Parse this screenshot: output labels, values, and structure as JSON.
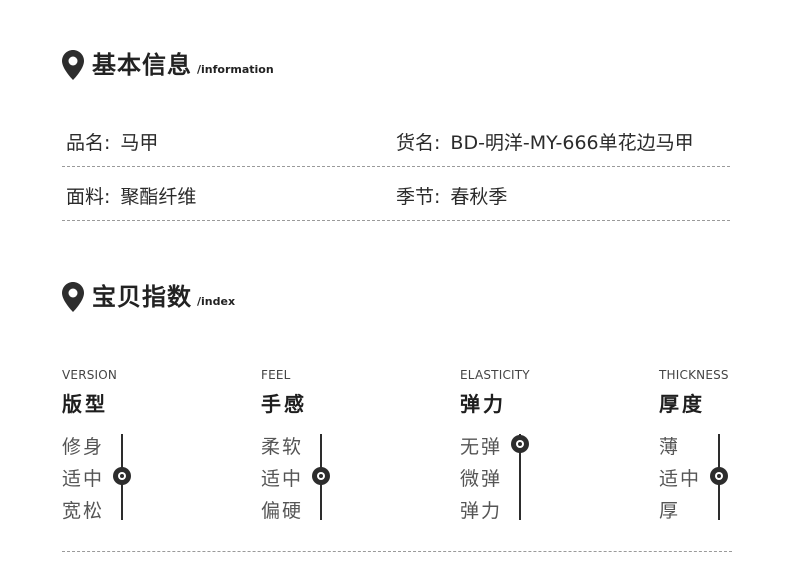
{
  "basic": {
    "title": "基本信息",
    "subtitle": "/information",
    "rows": [
      {
        "left_label": "品名:",
        "left_value": "马甲",
        "right_label": "货名:",
        "right_value": "BD-明洋-MY-666单花边马甲"
      },
      {
        "left_label": "面料:",
        "left_value": "聚酯纤维",
        "right_label": "季节:",
        "right_value": "春秋季"
      }
    ]
  },
  "index": {
    "title": "宝贝指数",
    "subtitle": "/index",
    "metrics": [
      {
        "en": "VERSION",
        "cn": "版型",
        "options": [
          "修身",
          "适中",
          "宽松"
        ],
        "selected": 1
      },
      {
        "en": "FEEL",
        "cn": "手感",
        "options": [
          "柔软",
          "适中",
          "偏硬"
        ],
        "selected": 1
      },
      {
        "en": "ELASTICITY",
        "cn": "弹力",
        "options": [
          "无弹",
          "微弹",
          "弹力"
        ],
        "selected": 0
      },
      {
        "en": "THICKNESS",
        "cn": "厚度",
        "options": [
          "薄",
          "适中",
          "厚"
        ],
        "selected": 1
      }
    ]
  },
  "icons": {
    "section_marker": "location-pin-icon"
  },
  "colors": {
    "text": "#2b2b2b",
    "accent": "#2d2d2d",
    "divider": "#9a9a9a"
  }
}
